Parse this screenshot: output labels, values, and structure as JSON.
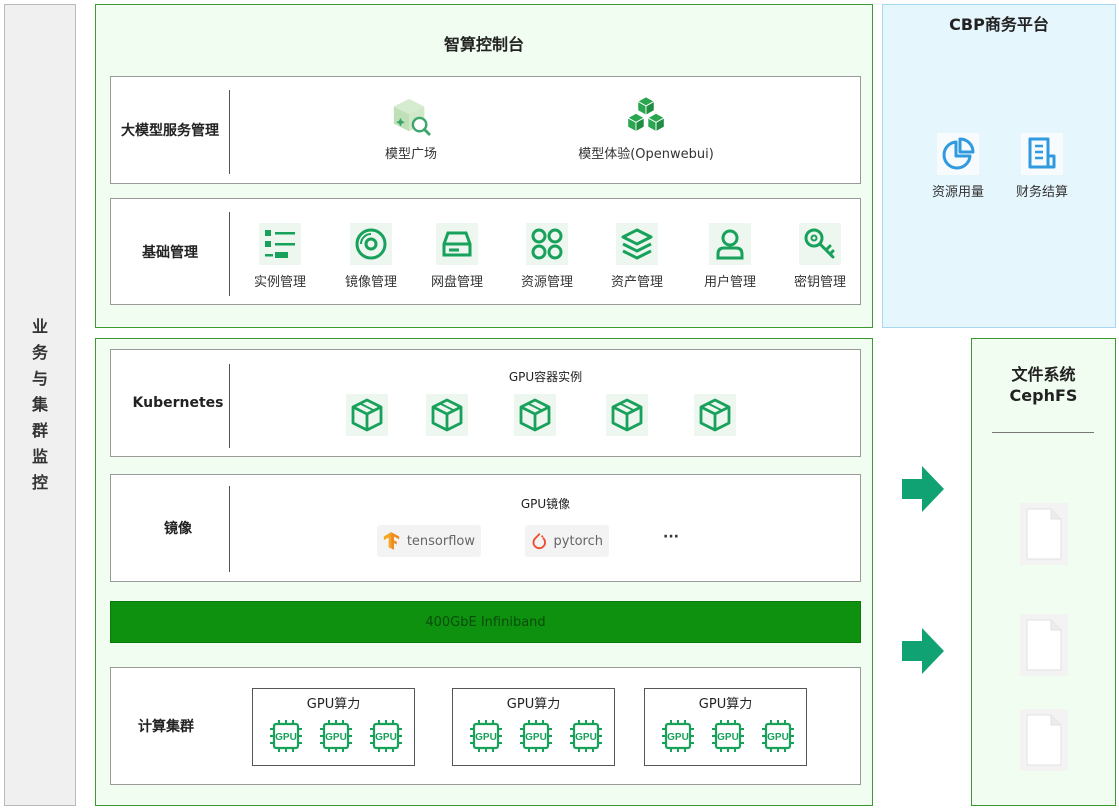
{
  "monitor": {
    "label": [
      "业",
      "务",
      "与",
      "集",
      "群",
      "监",
      "控"
    ]
  },
  "console": {
    "title": "智算控制台",
    "llm_row": {
      "label": "大模型服务管理",
      "items": [
        {
          "label": "模型广场",
          "icon": "model-square-icon"
        },
        {
          "label": "模型体验(Openwebui)",
          "icon": "cubes-icon"
        }
      ]
    },
    "base_row": {
      "label": "基础管理",
      "items": [
        {
          "label": "实例管理",
          "icon": "list-icon"
        },
        {
          "label": "镜像管理",
          "icon": "disc-icon"
        },
        {
          "label": "网盘管理",
          "icon": "drive-icon"
        },
        {
          "label": "资源管理",
          "icon": "grid-circles-icon"
        },
        {
          "label": "资产管理",
          "icon": "layers-icon"
        },
        {
          "label": "用户管理",
          "icon": "user-icon"
        },
        {
          "label": "密钥管理",
          "icon": "key-icon"
        }
      ]
    }
  },
  "cbp": {
    "title": "CBP商务平台",
    "items": [
      {
        "label": "资源用量",
        "icon": "pie-chart-icon"
      },
      {
        "label": "财务结算",
        "icon": "document-icon"
      }
    ]
  },
  "infra": {
    "k8s": {
      "label": "Kubernetes",
      "subtitle": "GPU容器实例",
      "icon": "container-icon",
      "count": 5
    },
    "image": {
      "label": "镜像",
      "subtitle": "GPU镜像",
      "frameworks": [
        "tensorflow",
        "pytorch"
      ],
      "more": "···"
    },
    "network": {
      "label": "400GbE Infiniband"
    },
    "compute": {
      "label": "计算集群",
      "groups": [
        {
          "title": "GPU算力",
          "chips": [
            "GPU",
            "GPU",
            "GPU"
          ]
        },
        {
          "title": "GPU算力",
          "chips": [
            "GPU",
            "GPU",
            "GPU"
          ]
        },
        {
          "title": "GPU算力",
          "chips": [
            "GPU",
            "GPU",
            "GPU"
          ]
        }
      ]
    }
  },
  "filesystem": {
    "title_line1": "文件系统",
    "title_line2": "CephFS",
    "icon": "file-icon",
    "count": 3
  },
  "colors": {
    "green": "#15a05a",
    "dark_green": "#0d910e",
    "blue": "#2f9ae0",
    "arrow": "#11a273"
  }
}
